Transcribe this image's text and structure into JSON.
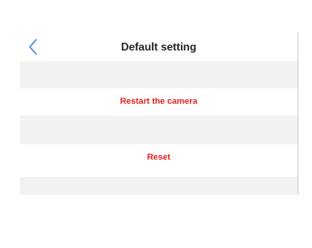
{
  "header": {
    "title": "Default setting",
    "back_icon": "chevron-left-icon"
  },
  "actions": [
    {
      "label": "Restart the camera"
    },
    {
      "label": "Reset"
    }
  ],
  "colors": {
    "accent": "#4a90d9",
    "danger": "#e51c1c",
    "band": "#f2f2f2"
  }
}
